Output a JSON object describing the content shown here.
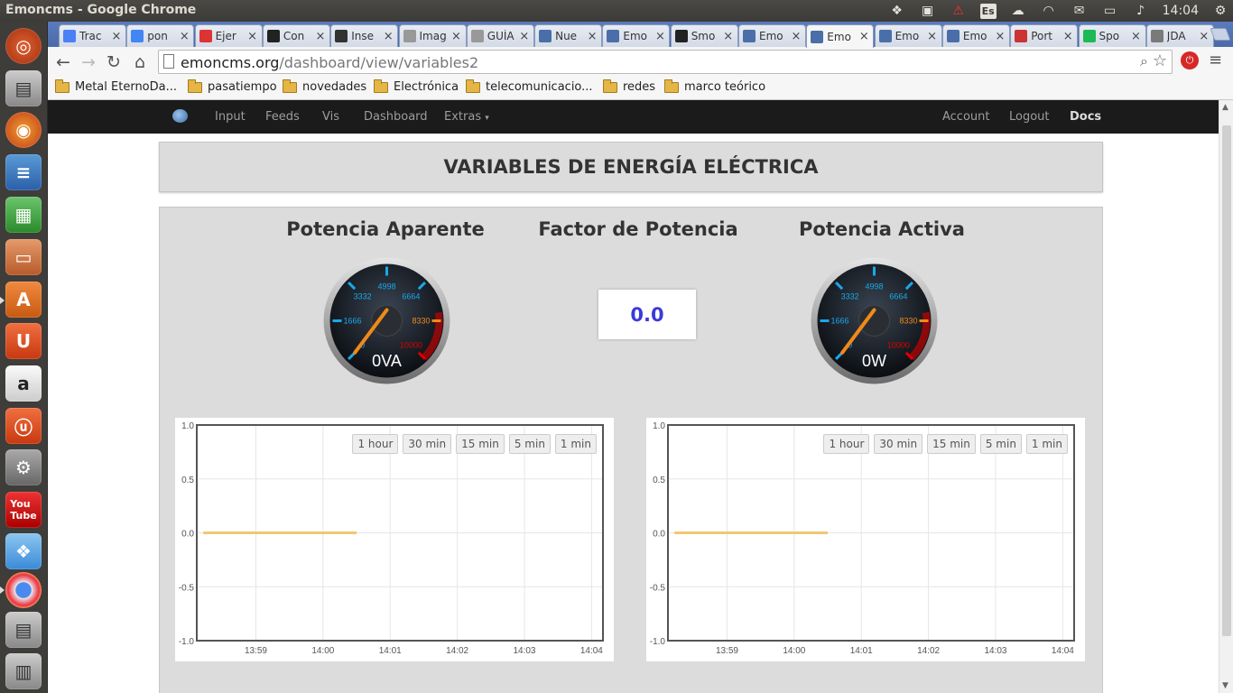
{
  "os": {
    "window_title": "Emoncms - Google Chrome",
    "keyboard_layout": "Es",
    "clock": "14:04"
  },
  "browser": {
    "tabs": [
      {
        "label": "Trac",
        "icon": "translate-icon",
        "color": "#4a80f5"
      },
      {
        "label": "pon",
        "icon": "google-plus-icon",
        "color": "#4285f4"
      },
      {
        "label": "Ejer",
        "icon": "ejercicios-icon",
        "color": "#d33"
      },
      {
        "label": "Con",
        "icon": "converter-icon",
        "color": "#222"
      },
      {
        "label": "Inse",
        "icon": "cursor-icon",
        "color": "#333"
      },
      {
        "label": "Imag",
        "icon": "page-icon",
        "color": "#999"
      },
      {
        "label": "GUÍA",
        "icon": "page-icon",
        "color": "#999"
      },
      {
        "label": "Nue",
        "icon": "oem-icon",
        "color": "#4a6fa8"
      },
      {
        "label": "Emo",
        "icon": "emoncms-icon",
        "color": "#4a6fa8"
      },
      {
        "label": "Smo",
        "icon": "github-icon",
        "color": "#222"
      },
      {
        "label": "Emo",
        "icon": "emoncms-icon",
        "color": "#4a6fa8"
      },
      {
        "label": "Emo",
        "icon": "emoncms-icon",
        "color": "#4a6fa8",
        "active": true
      },
      {
        "label": "Emo",
        "icon": "emoncms-icon",
        "color": "#4a6fa8"
      },
      {
        "label": "Emo",
        "icon": "emoncms-icon",
        "color": "#4a6fa8"
      },
      {
        "label": "Port",
        "icon": "portfolio-icon",
        "color": "#c33"
      },
      {
        "label": "Spo",
        "icon": "spotify-icon",
        "color": "#1db954"
      },
      {
        "label": "JDA",
        "icon": "s-icon",
        "color": "#7a7a7a"
      }
    ],
    "url_domain": "emoncms.org",
    "url_path": "/dashboard/view/variables2",
    "bookmarks": [
      {
        "label": "Metal EternoDa..."
      },
      {
        "label": "pasatiempo"
      },
      {
        "label": "novedades"
      },
      {
        "label": "Electrónica"
      },
      {
        "label": "telecomunicacio..."
      },
      {
        "label": "redes"
      },
      {
        "label": "marco teórico"
      }
    ]
  },
  "navbar": {
    "input": "Input",
    "feeds": "Feeds",
    "vis": "Vis",
    "dashboard": "Dashboard",
    "extras": "Extras",
    "account": "Account",
    "logout": "Logout",
    "docs": "Docs"
  },
  "dashboard": {
    "title": "VARIABLES DE ENERGÍA ELÉCTRICA",
    "widgets": {
      "apparent_title": "Potencia Aparente",
      "pf_title": "Factor de Potencia",
      "active_title": "Potencia Activa",
      "pf_value": "0.0"
    },
    "gauges": [
      {
        "name": "apparent",
        "value": 0,
        "max": 10000,
        "readout": "0VA",
        "tick_labels": [
          "0",
          "1666",
          "3332",
          "4998",
          "6664",
          "8330",
          "10000"
        ]
      },
      {
        "name": "active",
        "value": 0,
        "max": 10000,
        "readout": "0W",
        "tick_labels": [
          "0",
          "1666",
          "3332",
          "4998",
          "6664",
          "8330",
          "10000"
        ]
      }
    ],
    "range_buttons": [
      "1 hour",
      "30 min",
      "15 min",
      "5 min",
      "1 min"
    ],
    "colors": {
      "series": "#f0c870",
      "gauge_blue": "#1aa8e8",
      "gauge_orange": "#f08a1a",
      "gauge_red": "#d00"
    }
  },
  "chart_data": [
    {
      "type": "line",
      "ylim": [
        -1.0,
        1.0
      ],
      "yticks": [
        "1.0",
        "0.5",
        "0.0",
        "-0.5",
        "-1.0"
      ],
      "xticks": [
        "13:59",
        "14:00",
        "14:01",
        "14:02",
        "14:03",
        "14:04"
      ],
      "series": [
        {
          "x": [
            "13:58:13",
            "14:00:30"
          ],
          "values": [
            0.0,
            0.0
          ]
        }
      ],
      "grid": true
    },
    {
      "type": "line",
      "ylim": [
        -1.0,
        1.0
      ],
      "yticks": [
        "1.0",
        "0.5",
        "0.0",
        "-0.5",
        "-1.0"
      ],
      "xticks": [
        "13:59",
        "14:00",
        "14:01",
        "14:02",
        "14:03",
        "14:04"
      ],
      "series": [
        {
          "x": [
            "13:58:13",
            "14:00:30"
          ],
          "values": [
            0.0,
            0.0
          ]
        }
      ],
      "grid": true
    }
  ]
}
